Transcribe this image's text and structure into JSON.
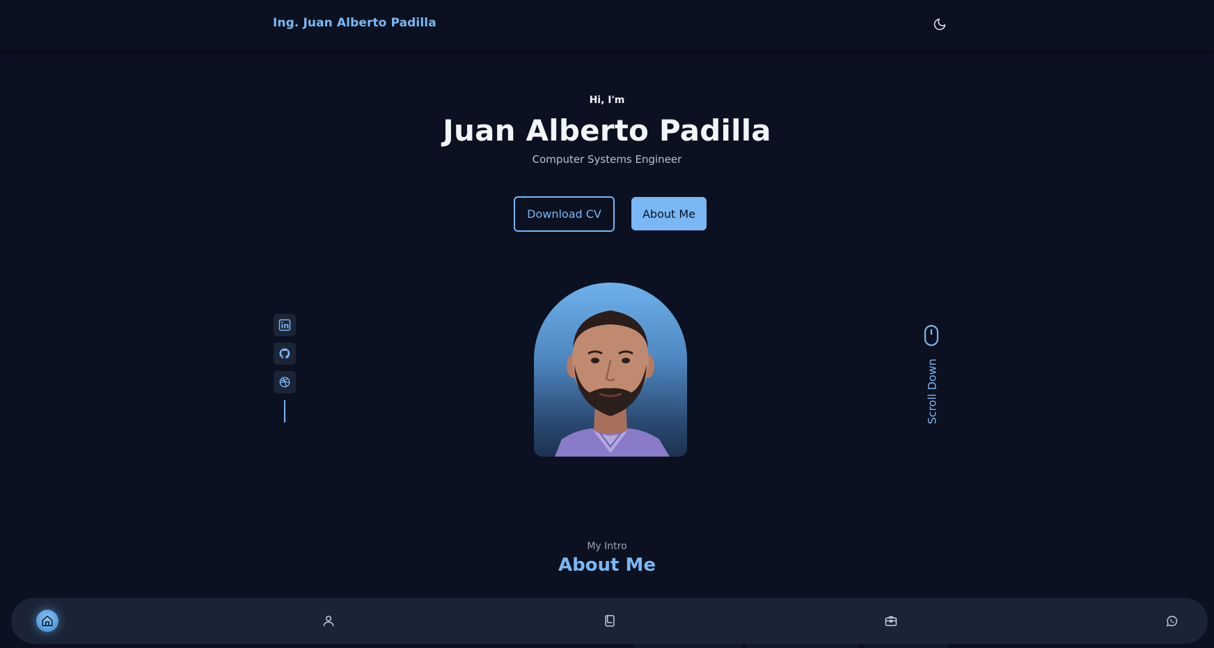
{
  "header": {
    "brand": "Ing. Juan Alberto Padilla",
    "theme_toggle_icon": "moon-icon"
  },
  "hero": {
    "greeting": "Hi, I'm",
    "name": "Juan Alberto Padilla",
    "role": "Computer Systems Engineer",
    "download_cv_label": "Download CV",
    "about_me_label": "About Me",
    "scroll_label": "Scroll Down"
  },
  "socials": [
    {
      "icon": "linkedin-icon"
    },
    {
      "icon": "github-icon"
    },
    {
      "icon": "dribbble-icon"
    }
  ],
  "intro": {
    "subtitle": "My Intro",
    "title": "About Me"
  },
  "bottom_nav": {
    "items": [
      {
        "icon": "home-icon",
        "active": true
      },
      {
        "icon": "user-icon",
        "active": false
      },
      {
        "icon": "book-icon",
        "active": false
      },
      {
        "icon": "briefcase-icon",
        "active": false
      },
      {
        "icon": "whatsapp-icon",
        "active": false
      }
    ]
  },
  "colors": {
    "background": "#0b1120",
    "accent": "#7ab8f5",
    "surface": "#1a2436",
    "text": "#f2f4f8"
  }
}
